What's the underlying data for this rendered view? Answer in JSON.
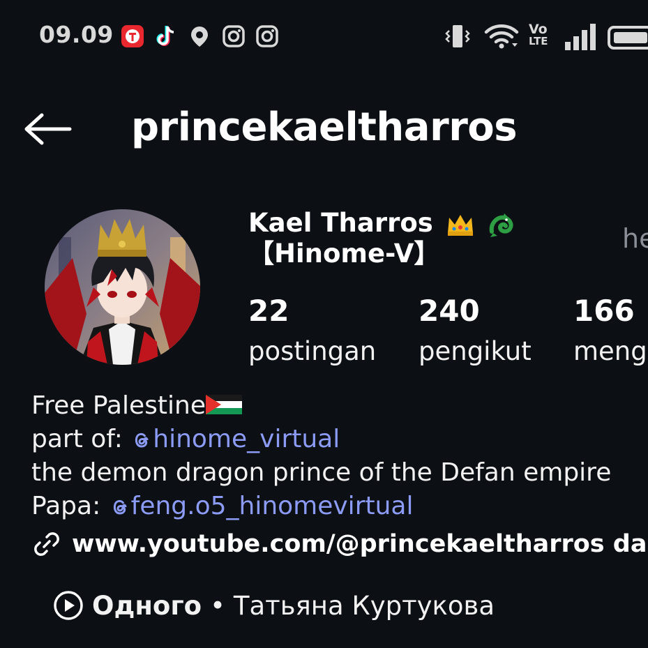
{
  "status_bar": {
    "time": "09.09",
    "volte_top": "Vo",
    "volte_bottom": "LTE"
  },
  "header": {
    "username": "princekaeltharros"
  },
  "profile": {
    "display_name_line1": "Kael Tharros",
    "display_name_line2": "【Hinome-V】",
    "side_hint": "he",
    "stats": [
      {
        "value": "22",
        "label": "postingan"
      },
      {
        "value": "240",
        "label": "pengikut"
      },
      {
        "value": "166",
        "label": "meng"
      }
    ]
  },
  "bio": {
    "line1": "Free Palestine",
    "line2_prefix": "part of: ",
    "line2_mention": "hinome_virtual",
    "line3": "the demon dragon prince of the Defan empire",
    "line4_prefix": "Papa: ",
    "line4_mention": "feng.o5_hinomevirtual"
  },
  "link": {
    "text": "www.youtube.com/@princekaeltharros dan"
  },
  "music": {
    "title": "Одного",
    "separator": "•",
    "artist": "Татьяна Куртукова"
  },
  "colors": {
    "background": "#0c0f14",
    "text": "#f2f2f2",
    "mention": "#8c9cf6",
    "muted": "#8a8f98"
  }
}
